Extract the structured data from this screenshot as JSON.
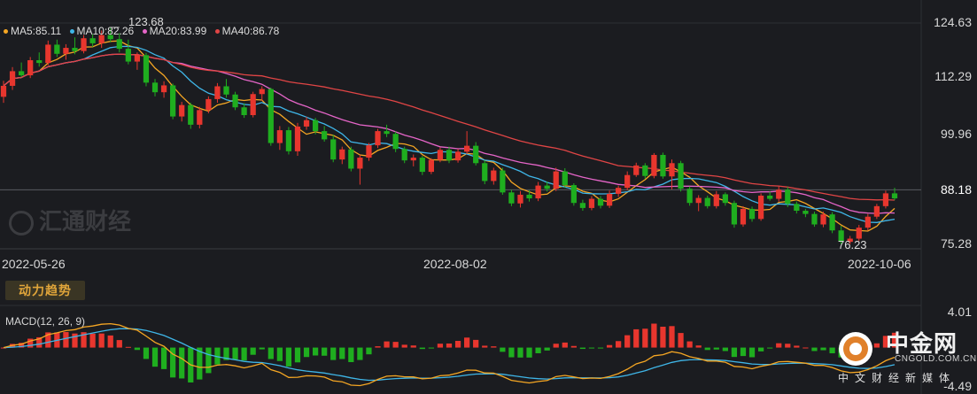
{
  "chart_data": [
    {
      "type": "candlestick",
      "legend": [
        {
          "text": "MA5:85.11",
          "color": "#f5a623"
        },
        {
          "text": "MA10:82.26",
          "color": "#3fb6e8"
        },
        {
          "text": "MA20:83.99",
          "color": "#e565c8"
        },
        {
          "text": "MA40:86.78",
          "color": "#e04545"
        }
      ],
      "y_axis_ticks": [
        "124.63",
        "112.29",
        "99.96",
        "88.18",
        "75.28"
      ],
      "x_axis_ticks": [
        "2022-05-26",
        "2022-08-02",
        "2022-10-06"
      ],
      "ylim": [
        75.28,
        124.63
      ],
      "reference_line": 88.18,
      "annotations": {
        "high": "123.68",
        "low": "76.23"
      },
      "up_color": "#e8362e",
      "down_color": "#1fae1f",
      "ohlc": [
        [
          108.5,
          112.0,
          107.2,
          110.9
        ],
        [
          110.9,
          115.0,
          110.0,
          114.1
        ],
        [
          114.1,
          116.0,
          112.8,
          113.2
        ],
        [
          113.2,
          117.2,
          112.6,
          116.5
        ],
        [
          116.5,
          118.2,
          115.1,
          115.9
        ],
        [
          115.9,
          120.8,
          115.4,
          119.9
        ],
        [
          119.9,
          121.0,
          117.2,
          117.9
        ],
        [
          117.9,
          120.0,
          116.6,
          119.2
        ],
        [
          119.2,
          121.5,
          117.8,
          118.5
        ],
        [
          118.5,
          122.0,
          118.0,
          121.3
        ],
        [
          121.3,
          122.2,
          119.4,
          120.2
        ],
        [
          120.2,
          123.0,
          119.2,
          122.0
        ],
        [
          122.0,
          123.68,
          120.4,
          121.1
        ],
        [
          121.1,
          122.4,
          118.2,
          119.0
        ],
        [
          119.0,
          121.0,
          115.6,
          116.2
        ],
        [
          116.2,
          118.2,
          114.4,
          117.6
        ],
        [
          117.6,
          118.1,
          110.8,
          111.6
        ],
        [
          111.6,
          112.4,
          108.6,
          109.5
        ],
        [
          109.5,
          111.9,
          108.3,
          111.0
        ],
        [
          111.0,
          111.4,
          103.6,
          104.2
        ],
        [
          104.2,
          107.4,
          103.1,
          106.7
        ],
        [
          106.7,
          107.2,
          101.5,
          102.4
        ],
        [
          102.4,
          106.3,
          101.6,
          105.6
        ],
        [
          105.6,
          108.6,
          104.9,
          108.0
        ],
        [
          108.0,
          111.5,
          107.2,
          110.8
        ],
        [
          110.8,
          112.4,
          108.3,
          109.0
        ],
        [
          109.0,
          109.6,
          105.6,
          106.2
        ],
        [
          106.2,
          107.1,
          103.9,
          104.5
        ],
        [
          104.5,
          109.6,
          104.0,
          109.1
        ],
        [
          109.1,
          110.8,
          107.6,
          110.2
        ],
        [
          110.2,
          110.5,
          97.8,
          98.4
        ],
        [
          98.4,
          102.1,
          96.9,
          101.2
        ],
        [
          101.2,
          101.9,
          95.9,
          96.6
        ],
        [
          96.6,
          102.8,
          95.6,
          102.0
        ],
        [
          102.0,
          104.1,
          101.3,
          103.4
        ],
        [
          103.4,
          103.9,
          100.3,
          101.0
        ],
        [
          101.0,
          102.1,
          98.7,
          99.2
        ],
        [
          99.2,
          100.2,
          94.2,
          94.8
        ],
        [
          94.8,
          97.6,
          93.8,
          97.0
        ],
        [
          97.0,
          97.6,
          92.2,
          92.8
        ],
        [
          92.8,
          95.8,
          89.3,
          95.2
        ],
        [
          95.2,
          98.4,
          94.5,
          97.9
        ],
        [
          97.9,
          101.5,
          97.3,
          101.0
        ],
        [
          101.0,
          102.4,
          99.7,
          100.4
        ],
        [
          100.4,
          100.9,
          96.4,
          97.1
        ],
        [
          97.1,
          97.6,
          94.0,
          94.6
        ],
        [
          94.6,
          95.9,
          93.3,
          95.2
        ],
        [
          95.2,
          95.6,
          91.4,
          92.1
        ],
        [
          92.1,
          95.1,
          91.6,
          94.7
        ],
        [
          94.7,
          97.4,
          94.2,
          96.9
        ],
        [
          96.9,
          97.6,
          94.0,
          94.6
        ],
        [
          94.6,
          97.1,
          94.1,
          96.5
        ],
        [
          96.5,
          101.0,
          96.0,
          97.8
        ],
        [
          97.8,
          98.6,
          93.5,
          94.0
        ],
        [
          94.0,
          94.6,
          89.4,
          90.1
        ],
        [
          90.1,
          93.0,
          89.3,
          92.4
        ],
        [
          92.4,
          93.0,
          87.1,
          87.6
        ],
        [
          87.6,
          88.2,
          84.6,
          85.2
        ],
        [
          85.2,
          87.9,
          84.3,
          87.1
        ],
        [
          87.1,
          88.1,
          85.6,
          86.3
        ],
        [
          86.3,
          89.9,
          85.7,
          89.1
        ],
        [
          89.1,
          90.0,
          87.8,
          88.4
        ],
        [
          88.4,
          93.0,
          87.9,
          92.2
        ],
        [
          92.2,
          92.9,
          88.6,
          89.2
        ],
        [
          89.2,
          89.6,
          84.7,
          85.3
        ],
        [
          85.3,
          86.0,
          83.6,
          84.2
        ],
        [
          84.2,
          86.8,
          83.7,
          86.2
        ],
        [
          86.2,
          86.8,
          84.1,
          84.7
        ],
        [
          84.7,
          88.0,
          84.2,
          87.3
        ],
        [
          87.3,
          89.1,
          86.6,
          88.6
        ],
        [
          88.6,
          92.2,
          88.1,
          91.4
        ],
        [
          91.4,
          94.1,
          91.0,
          93.5
        ],
        [
          93.5,
          94.0,
          90.6,
          91.2
        ],
        [
          91.2,
          96.2,
          90.7,
          95.8
        ],
        [
          95.8,
          96.3,
          90.6,
          91.1
        ],
        [
          91.1,
          94.8,
          88.3,
          94.0
        ],
        [
          94.0,
          94.5,
          87.8,
          88.4
        ],
        [
          88.4,
          88.9,
          84.7,
          85.3
        ],
        [
          85.3,
          87.0,
          83.5,
          86.4
        ],
        [
          86.4,
          86.9,
          84.1,
          84.6
        ],
        [
          84.6,
          87.9,
          84.1,
          87.2
        ],
        [
          87.2,
          87.6,
          84.7,
          85.3
        ],
        [
          85.3,
          85.8,
          79.9,
          80.6
        ],
        [
          80.6,
          84.6,
          80.1,
          84.0
        ],
        [
          84.0,
          84.5,
          81.2,
          81.8
        ],
        [
          81.8,
          87.4,
          81.4,
          86.9
        ],
        [
          86.9,
          87.8,
          85.8,
          86.2
        ],
        [
          86.2,
          88.9,
          85.6,
          88.2
        ],
        [
          88.2,
          88.8,
          84.4,
          85.1
        ],
        [
          85.1,
          85.6,
          83.0,
          83.6
        ],
        [
          83.6,
          84.0,
          82.2,
          82.9
        ],
        [
          82.9,
          83.4,
          80.1,
          80.6
        ],
        [
          80.6,
          83.4,
          80.0,
          82.8
        ],
        [
          82.8,
          83.3,
          78.7,
          79.3
        ],
        [
          79.3,
          80.3,
          76.23,
          76.8
        ],
        [
          76.8,
          78.1,
          76.3,
          77.5
        ],
        [
          77.5,
          80.5,
          77.0,
          79.9
        ],
        [
          79.9,
          82.9,
          79.3,
          82.3
        ],
        [
          82.3,
          85.1,
          81.8,
          84.6
        ],
        [
          84.6,
          88.0,
          84.1,
          87.4
        ],
        [
          87.4,
          88.6,
          85.9,
          86.3
        ]
      ]
    },
    {
      "type": "macd",
      "title": "MACD(12, 26, 9)",
      "y_axis_ticks": [
        "4.01",
        "-4.49"
      ],
      "ylim": [
        -4.49,
        4.01
      ],
      "up_color": "#e8362e",
      "down_color": "#1fae1f"
    }
  ],
  "panel": {
    "badge": "动力趋势"
  },
  "watermark": {
    "text": "汇通财经"
  },
  "logo": {
    "name": "中金网",
    "url": "CNGOLD.COM.CN",
    "sub": "中文财经新媒体"
  }
}
